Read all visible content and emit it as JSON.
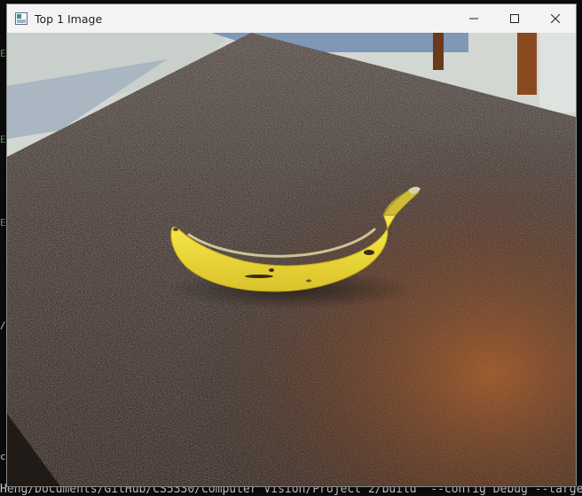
{
  "window": {
    "title": "Top 1 Image",
    "controls": {
      "minimize_icon": "minimize-icon",
      "maximize_icon": "maximize-icon",
      "close_icon": "close-icon"
    }
  },
  "image": {
    "subject": "banana-on-countertop-photo",
    "colors": {
      "counter": "#3c322c",
      "banana": "#f0e04a",
      "background_wall": "#d8dcd8",
      "floor_blue": "#7f98b8",
      "table_leg": "#8a4a20"
    }
  },
  "terminal": {
    "bottom_line": "Heng/Documents/GitHub/CS5330/Computer Vision/Project 2/build\" --config Debug --target",
    "left_fragments": [
      "ER",
      "ER",
      "ER",
      "/",
      "c"
    ]
  }
}
